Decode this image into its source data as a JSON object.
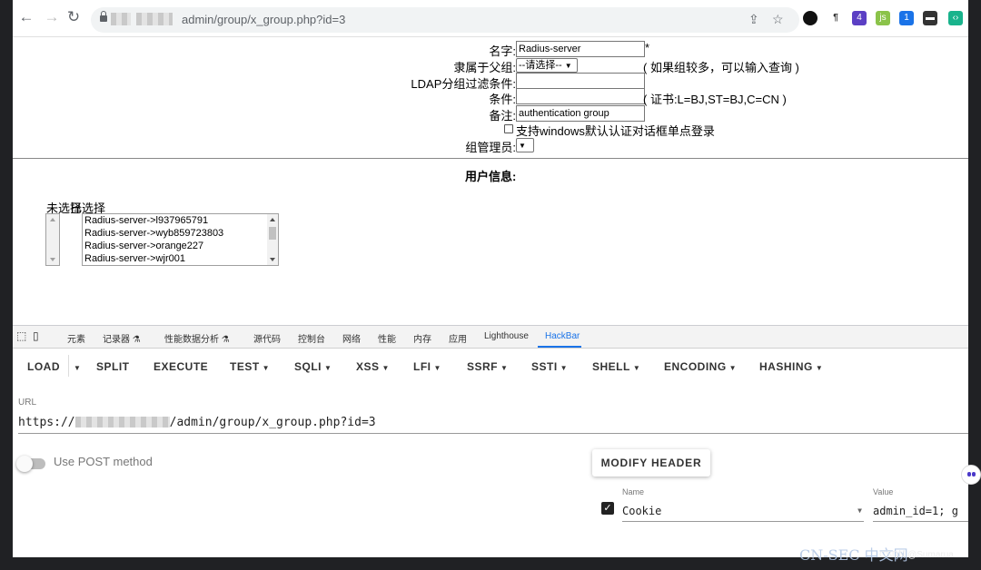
{
  "browser": {
    "url_suffix": "admin/group/x_group.php?id=3",
    "ext_badges": [
      "4",
      "1"
    ]
  },
  "form": {
    "name_label": "名字:",
    "name_value": "Radius-server",
    "required_mark": "*",
    "parent_label": "隶属于父组:",
    "parent_select": "--请选择--",
    "parent_hint": "( 如果组较多，可以输入查询 )",
    "ldap_label": "LDAP分组过滤条件:",
    "condition_label": "条件:",
    "condition_hint": "( 证书:L=BJ,ST=BJ,C=CN )",
    "note_label": "备注:",
    "note_value": "authentication group",
    "windows_sso_label": "支持windows默认认证对话框单点登录",
    "admin_label": "组管理员:"
  },
  "user_info": {
    "title": "用户信息:",
    "unselected_label": "未选择",
    "selected_label": "已选择",
    "selected_users": [
      "Radius-server->l937965791",
      "Radius-server->wyb859723803",
      "Radius-server->orange227",
      "Radius-server->wjr001"
    ]
  },
  "devtools": {
    "tabs": [
      "元素",
      "记录器 ⚗",
      "性能数据分析 ⚗",
      "源代码",
      "控制台",
      "网络",
      "性能",
      "内存",
      "应用",
      "Lighthouse",
      "HackBar"
    ],
    "active_tab": "HackBar"
  },
  "hackbar": {
    "buttons": [
      {
        "label": "LOAD",
        "caret": false
      },
      {
        "label": "SPLIT",
        "caret": false
      },
      {
        "label": "EXECUTE",
        "caret": false
      },
      {
        "label": "TEST",
        "caret": true
      },
      {
        "label": "SQLI",
        "caret": true
      },
      {
        "label": "XSS",
        "caret": true
      },
      {
        "label": "LFI",
        "caret": true
      },
      {
        "label": "SSRF",
        "caret": true
      },
      {
        "label": "SSTI",
        "caret": true
      },
      {
        "label": "SHELL",
        "caret": true
      },
      {
        "label": "ENCODING",
        "caret": true
      },
      {
        "label": "HASHING",
        "caret": true
      }
    ],
    "url_label": "URL",
    "url_prefix": "https://",
    "url_suffix": "/admin/group/x_group.php?id=3",
    "post_label": "Use POST method",
    "post_enabled": false,
    "modify_header_label": "MODIFY HEADER",
    "header_name_label": "Name",
    "header_name_value": "Cookie",
    "header_value_label": "Value",
    "header_value_value": "admin_id=1; g",
    "header_enabled": true
  },
  "watermark": {
    "brand": "CN-SEC 中文网",
    "credit": "CSDN @Sumarua"
  }
}
